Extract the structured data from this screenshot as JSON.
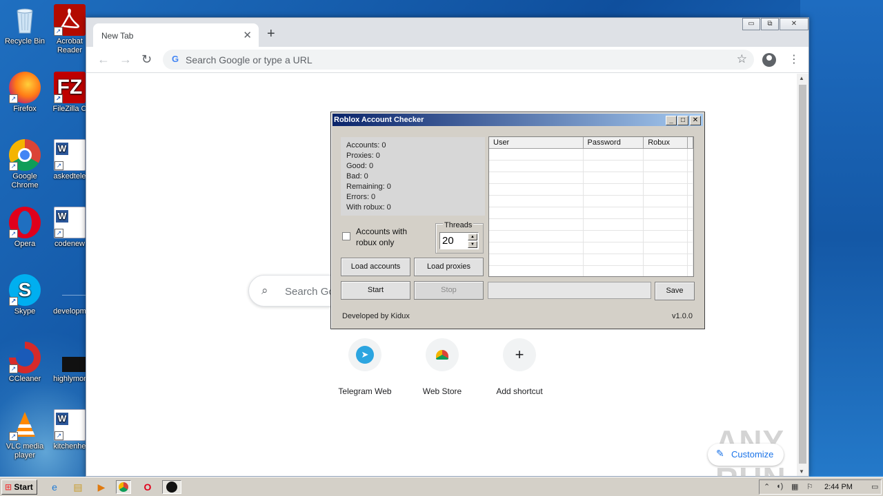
{
  "desktop": {
    "icons": [
      {
        "label": "Recycle Bin"
      },
      {
        "label": "Acrobat Reader"
      },
      {
        "label": "Firefox"
      },
      {
        "label": "FileZilla C"
      },
      {
        "label": "Google Chrome"
      },
      {
        "label": "askedtele"
      },
      {
        "label": "Opera"
      },
      {
        "label": "codenew"
      },
      {
        "label": "Skype"
      },
      {
        "label": "developm"
      },
      {
        "label": "CCleaner"
      },
      {
        "label": "highlymor"
      },
      {
        "label": "VLC media player"
      },
      {
        "label": "kitchenhe"
      }
    ]
  },
  "browser": {
    "tab_title": "New Tab",
    "tab_close": "✕",
    "new_tab": "+",
    "window_controls": {
      "minimize": "▭",
      "restore": "⧉",
      "close": "✕"
    },
    "nav": {
      "back": "←",
      "forward": "→",
      "reload": "↻"
    },
    "omnibox_placeholder": "Search Google or type a URL",
    "star": "☆",
    "menu": "⋮",
    "ntp": {
      "search_placeholder": "Search Go",
      "shortcuts": [
        {
          "label": "Telegram Web",
          "icon": "telegram-icon"
        },
        {
          "label": "Web Store",
          "icon": "chrome-webstore-icon"
        },
        {
          "label": "Add shortcut",
          "icon": "plus-icon"
        }
      ],
      "customize": "Customize"
    },
    "watermark": "ANY RUN"
  },
  "checker": {
    "title": "Roblox Account Checker",
    "stats": [
      "Accounts: 0",
      "Proxies: 0",
      "Good: 0",
      "Bad: 0",
      "Remaining: 0",
      "Errors: 0",
      "With robux: 0"
    ],
    "checkbox_label": "Accounts with robux only",
    "checkbox_checked": false,
    "threads_label": "Threads",
    "threads_value": "20",
    "buttons": {
      "load_accounts": "Load accounts",
      "load_proxies": "Load proxies",
      "start": "Start",
      "stop": "Stop",
      "save": "Save"
    },
    "table": {
      "columns": [
        "User",
        "Password",
        "Robux"
      ],
      "rows": []
    },
    "footer_left": "Developed by Kidux",
    "footer_right": "v1.0.0"
  },
  "taskbar": {
    "start": "Start",
    "clock": "2:44 PM"
  },
  "colors": {
    "titlebar_start": "#0a246a",
    "titlebar_end": "#a6caf0",
    "chrome_blue": "#1a73e8"
  }
}
